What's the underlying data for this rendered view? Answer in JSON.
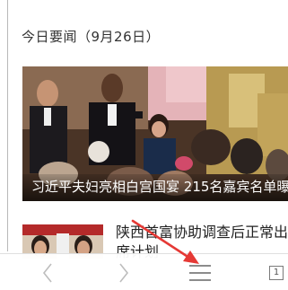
{
  "section": {
    "title": "今日要闻（9月26日）"
  },
  "hero": {
    "caption": "习近平夫妇亮相白宫国宴 215名嘉宾名单曝"
  },
  "news_item": {
    "title": "陕西首富协助调查后正常出席计划"
  },
  "toolbar": {
    "back_icon": "chevron-left-icon",
    "forward_icon": "chevron-right-icon",
    "menu_icon": "menu-icon",
    "tab_count": "1"
  },
  "annotation": {
    "arrow_color": "#e53935"
  }
}
